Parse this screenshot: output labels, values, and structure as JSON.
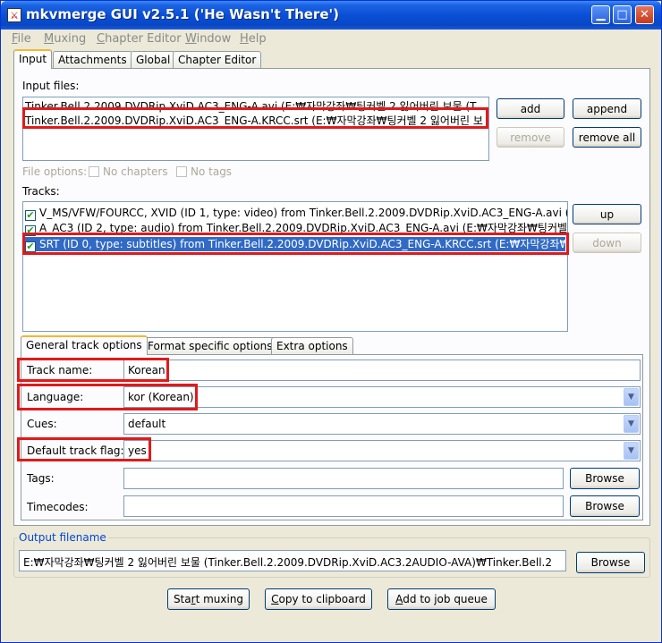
{
  "window": {
    "title": "mkvmerge GUI v2.5.1 ('He Wasn't There')",
    "icon_glyph": "⚔"
  },
  "title_buttons": {
    "minimize": "▁",
    "maximize": "□",
    "close": "✕"
  },
  "menubar": {
    "items": [
      {
        "key": "F",
        "rest": "ile"
      },
      {
        "key": "M",
        "rest": "uxing"
      },
      {
        "key": "C",
        "rest": "hapter Editor"
      },
      {
        "key": "W",
        "rest": "indow"
      },
      {
        "key": "H",
        "rest": "elp"
      }
    ]
  },
  "main_tabs": [
    "Input",
    "Attachments",
    "Global",
    "Chapter Editor"
  ],
  "input": {
    "input_files_label": "Input files:",
    "files": [
      "Tinker.Bell.2.2009.DVDRip.XviD.AC3_ENG-A.avi (E:₩자막강좌₩팅커벨 2 잃어버린 보물 (T",
      "Tinker.Bell.2.2009.DVDRip.XviD.AC3_ENG-A.KRCC.srt (E:₩자막강좌₩팅커벨 2 잃어버린 보"
    ],
    "buttons": {
      "add": "add",
      "append": "append",
      "remove": "remove",
      "remove_all": "remove all"
    },
    "file_options_label": "File options:",
    "no_chapters": "No chapters",
    "no_tags": "No tags",
    "tracks_label": "Tracks:",
    "tracks": [
      "V_MS/VFW/FOURCC, XVID (ID 1, type: video) from Tinker.Bell.2.2009.DVDRip.XviD.AC3_ENG-A.avi (E",
      "A_AC3 (ID 2, type: audio) from Tinker.Bell.2.2009.DVDRip.XviD.AC3_ENG-A.avi (E:₩자막강좌₩팅커벨",
      "SRT (ID 0, type: subtitles) from Tinker.Bell.2.2009.DVDRip.XviD.AC3_ENG-A.KRCC.srt (E:₩자막강좌₩"
    ],
    "check_glyph": "✔",
    "up": "up",
    "down": "down"
  },
  "track_tabs": [
    "General track options",
    "Format specific options",
    "Extra options"
  ],
  "track_options": {
    "track_name_label": "Track name:",
    "track_name_value": "Korean",
    "language_label": "Language:",
    "language_value": "kor (Korean)",
    "cues_label": "Cues:",
    "cues_value": "default",
    "default_flag_label": "Default track flag:",
    "default_flag_value": "yes",
    "tags_label": "Tags:",
    "timecodes_label": "Timecodes:",
    "browse": "Browse",
    "combo_arrow": "▼"
  },
  "output": {
    "label": "Output filename",
    "value": "E:₩자막강좌₩팅커벨 2 잃어버린 보물 (Tinker.Bell.2.2009.DVDRip.XviD.AC3.2AUDIO-AVA)₩Tinker.Bell.2",
    "browse": "Browse"
  },
  "actions": {
    "start_key": "Sta",
    "start_u": "r",
    "start_rest": "t muxing",
    "copy_key": "",
    "copy_u": "C",
    "copy_rest": "opy to clipboard",
    "queue_key": "",
    "queue_u": "A",
    "queue_rest": "dd to job queue"
  },
  "colors": {
    "highlight_red": "#e01a1a",
    "selection_blue": "#316ac5"
  }
}
